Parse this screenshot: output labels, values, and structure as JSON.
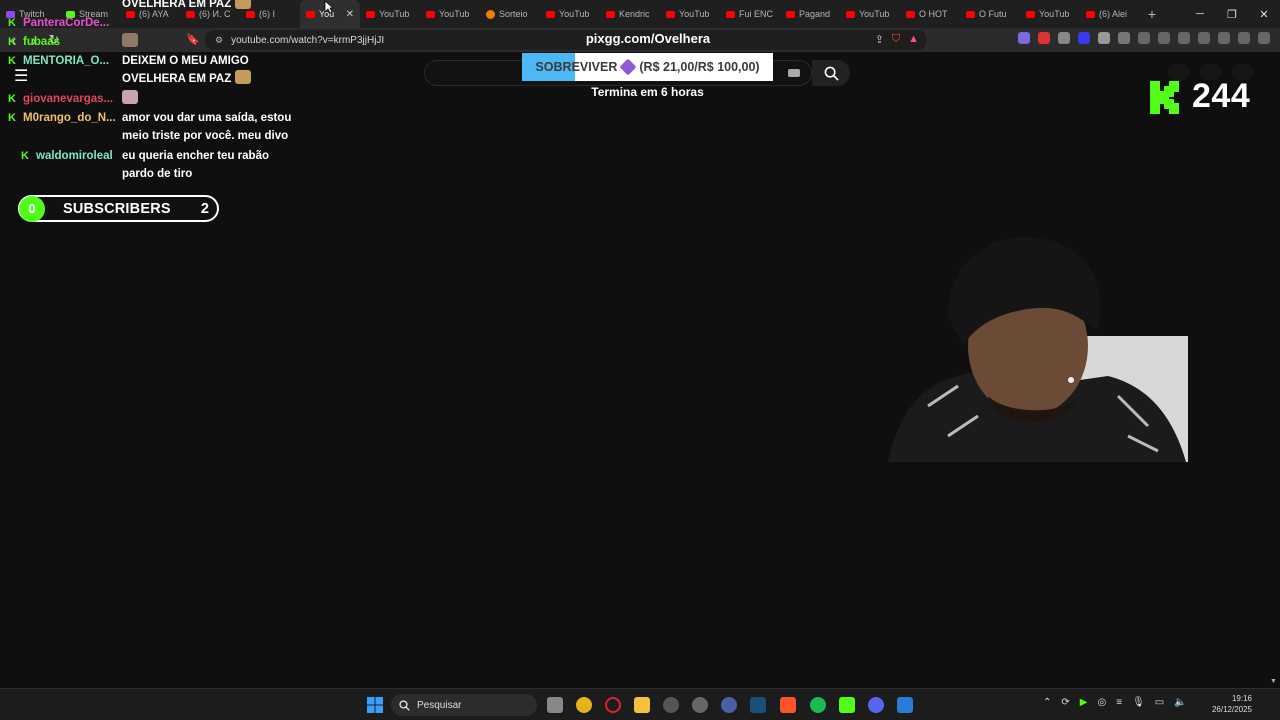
{
  "browser": {
    "tabs": [
      {
        "label": "Twitch",
        "icon": "twitch-favicon"
      },
      {
        "label": "Stream",
        "icon": "kick-favicon"
      },
      {
        "label": "(6) AYA",
        "icon": "youtube-favicon"
      },
      {
        "label": "(6) И. С",
        "icon": "youtube-favicon"
      },
      {
        "label": "(6) I",
        "icon": "speaker-icon"
      },
      {
        "label": "You",
        "icon": "youtube-favicon",
        "active": true
      },
      {
        "label": "YouTub",
        "icon": "youtube-favicon"
      },
      {
        "label": "YouTub",
        "icon": "youtube-favicon"
      },
      {
        "label": "Sorteio",
        "icon": "s-favicon"
      },
      {
        "label": "YouTub",
        "icon": "youtube-favicon"
      },
      {
        "label": "Kendric",
        "icon": "youtube-favicon"
      },
      {
        "label": "YouTub",
        "icon": "youtube-favicon"
      },
      {
        "label": "Fui ENC",
        "icon": "youtube-favicon"
      },
      {
        "label": "Pagand",
        "icon": "youtube-favicon"
      },
      {
        "label": "YouTub",
        "icon": "youtube-favicon"
      },
      {
        "label": "O HOT",
        "icon": "youtube-favicon"
      },
      {
        "label": "O Futu",
        "icon": "youtube-favicon"
      },
      {
        "label": "YouTub",
        "icon": "youtube-favicon"
      },
      {
        "label": "(6) Alei",
        "icon": "youtube-favicon"
      }
    ],
    "new_tab": "+",
    "url": "youtube.com/watch?v=krmP3jjHjJI"
  },
  "overlay": {
    "chat": [
      {
        "user": "PanteraCorDe...",
        "user_color": "#e94fd0",
        "message": "OVELHERA EM PAZ",
        "emote": "cat"
      },
      {
        "user": "fubaas",
        "user_color": "#53fc18",
        "message": "",
        "emote": "face"
      },
      {
        "user": "MENTORIA_O...",
        "user_color": "#7ee8c8",
        "message": "DEIXEM O MEU AMIGO",
        "message2": "OVELHERA EM PAZ",
        "emote": "cat"
      },
      {
        "user": "giovanevargas...",
        "user_color": "#e0465c",
        "message": "",
        "emote": "hand"
      },
      {
        "user": "M0rango_do_N...",
        "user_color": "#f0c06a",
        "message": "amor vou dar uma saída, estou",
        "message2": "meio triste por você. meu divo"
      },
      {
        "user": "waldomiroleal",
        "user_color": "#7ee8c8",
        "message": "eu queria encher teu rabão",
        "message2": "pardo de tiro"
      }
    ],
    "subs_goal": {
      "current": "0",
      "label": "SUBSCRIBERS",
      "target": "2"
    },
    "pixgg": {
      "title": "pixgg.com/Ovelhera",
      "goal_label": "SOBREVIVER",
      "goal_amount": "(R$ 21,00/R$ 100,00)",
      "progress_fraction": 0.21,
      "ends_in": "Termina em 6 horas"
    },
    "viewers": "244"
  },
  "taskbar": {
    "search_placeholder": "Pesquisar",
    "time": "19:16",
    "date": "26/12/2025"
  },
  "colors": {
    "kick_green": "#53fc18",
    "goal_blue": "#4cb8f5",
    "youtube_red": "#ff0000"
  }
}
